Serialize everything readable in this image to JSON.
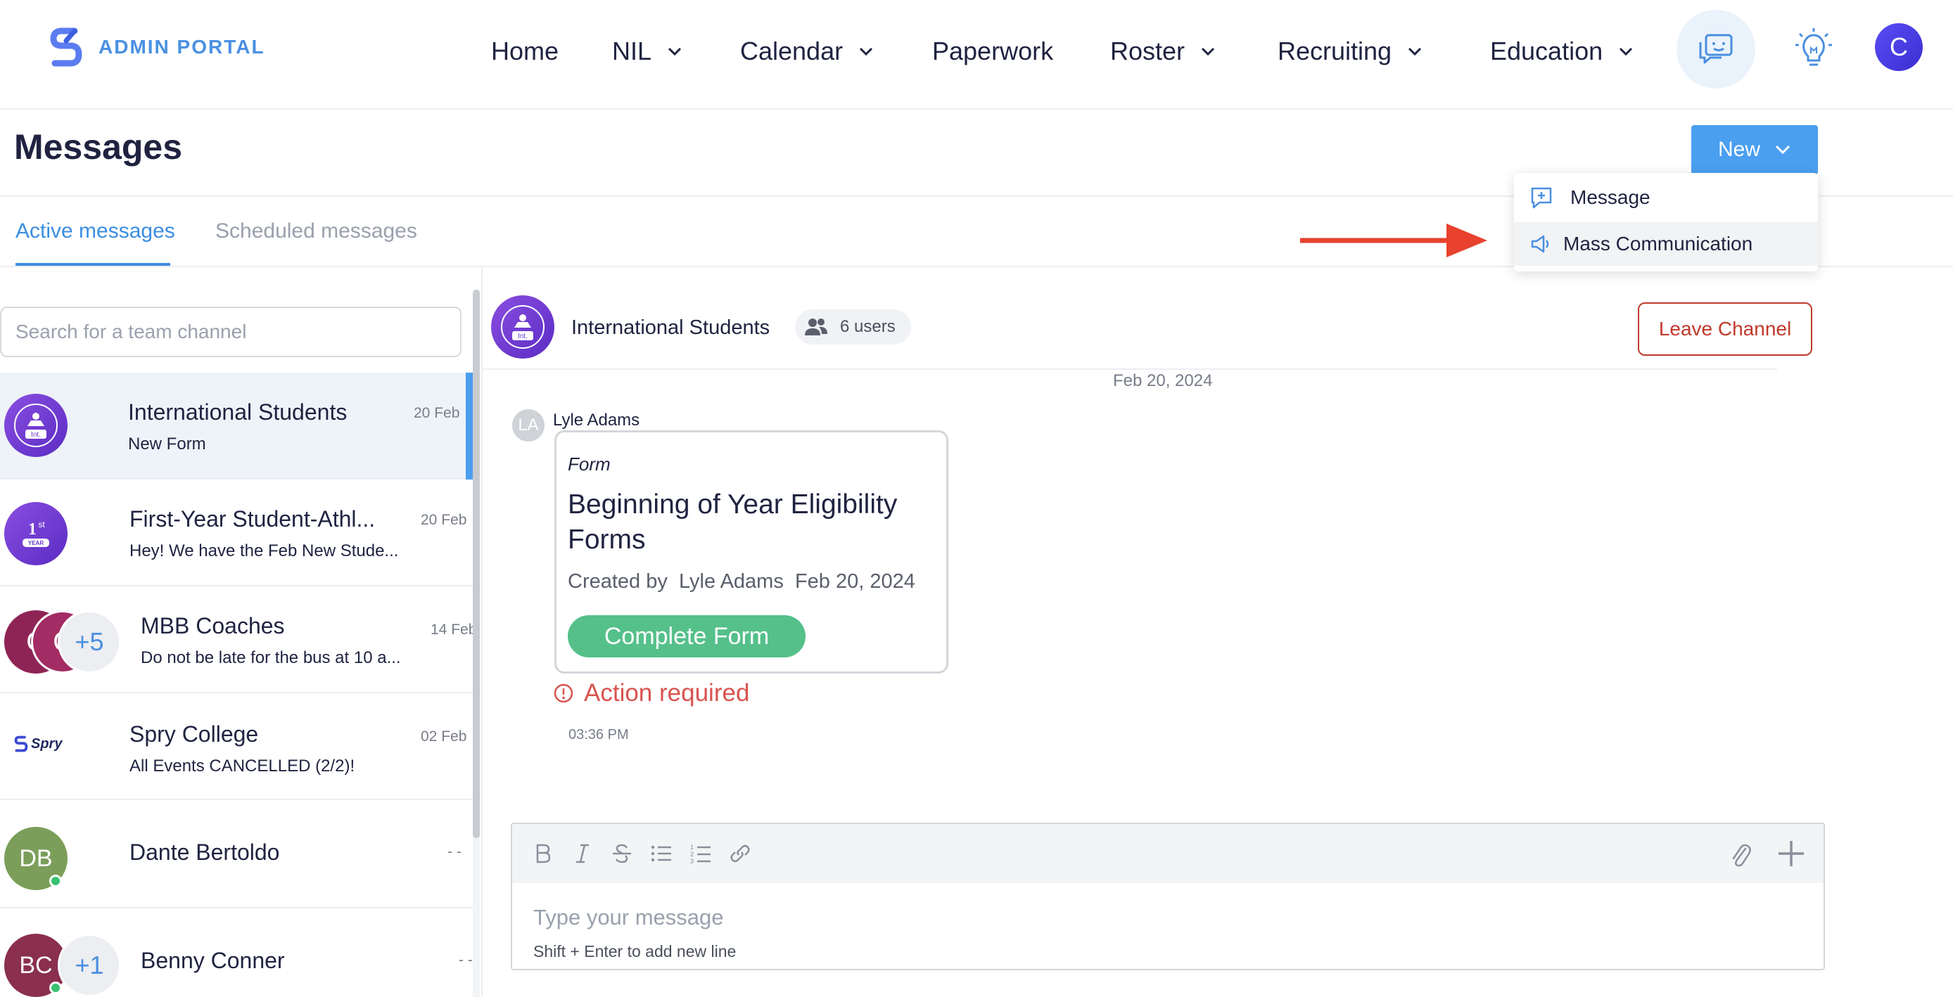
{
  "brand": {
    "name": "ADMIN PORTAL",
    "color": "#4a90e2"
  },
  "nav": {
    "items": [
      {
        "label": "Home",
        "has_dropdown": false
      },
      {
        "label": "NIL",
        "has_dropdown": true
      },
      {
        "label": "Calendar",
        "has_dropdown": true
      },
      {
        "label": "Paperwork",
        "has_dropdown": false
      },
      {
        "label": "Roster",
        "has_dropdown": true
      },
      {
        "label": "Recruiting",
        "has_dropdown": true
      },
      {
        "label": "Education",
        "has_dropdown": true
      }
    ],
    "icons": [
      "chat-icon",
      "lightbulb-icon"
    ],
    "user_initial": "C"
  },
  "page": {
    "title": "Messages",
    "new_button": "New"
  },
  "tabs": [
    {
      "label": "Active messages",
      "active": true
    },
    {
      "label": "Scheduled messages",
      "active": false
    }
  ],
  "new_menu": {
    "items": [
      {
        "label": "Message",
        "icon": "message-plus-icon"
      },
      {
        "label": "Mass Communication",
        "icon": "megaphone-icon",
        "hovered": true
      }
    ]
  },
  "search": {
    "placeholder": "Search for a team channel"
  },
  "channels": [
    {
      "name": "International Students",
      "preview": "New Form",
      "date": "20 Feb",
      "avatar_text": "Int.",
      "active": true
    },
    {
      "name": "First-Year Student-Athl...",
      "preview": "Hey! We have the Feb New Stude...",
      "date": "20 Feb",
      "avatar_text": "1st YEAR"
    },
    {
      "name": "MBB Coaches",
      "preview": "Do not be late for the bus at 10 a...",
      "date": "14 Feb",
      "avatar_text": "C",
      "extra_count": "+5"
    },
    {
      "name": "Spry College",
      "preview": "All Events CANCELLED (2/2)!",
      "date": "02 Feb",
      "avatar_text": "Spry"
    },
    {
      "name": "Dante Bertoldo",
      "preview": "",
      "date": "- -",
      "avatar_text": "DB",
      "online": true
    },
    {
      "name": "Benny Conner",
      "preview": "",
      "date": "- -",
      "avatar_text": "BC",
      "extra_count": "+1",
      "online": true
    }
  ],
  "chat": {
    "channel_name": "International Students",
    "users_count": "6 users",
    "leave_button": "Leave Channel",
    "date_separator": "Feb 20, 2024",
    "message": {
      "author_initials": "LA",
      "author": "Lyle Adams",
      "form_kind": "Form",
      "form_title": "Beginning of Year Eligibility Forms",
      "created_by_label": "Created by",
      "created_by": "Lyle Adams",
      "created_date": "Feb 20, 2024",
      "complete_button": "Complete Form",
      "status": "Action required",
      "time": "03:36 PM"
    },
    "composer": {
      "placeholder": "Type your message",
      "hint": "Shift + Enter to add new line",
      "tools": [
        "bold-icon",
        "italic-icon",
        "strikethrough-icon",
        "bullet-list-icon",
        "numbered-list-icon",
        "link-icon",
        "attachment-icon",
        "plus-icon"
      ]
    }
  },
  "colors": {
    "accent": "#4a9ff0",
    "link": "#3b8de0",
    "danger": "#c0392b",
    "success": "#55c08a",
    "channel_purple": "#7a3fd8",
    "arrow_red": "#e8412d"
  }
}
